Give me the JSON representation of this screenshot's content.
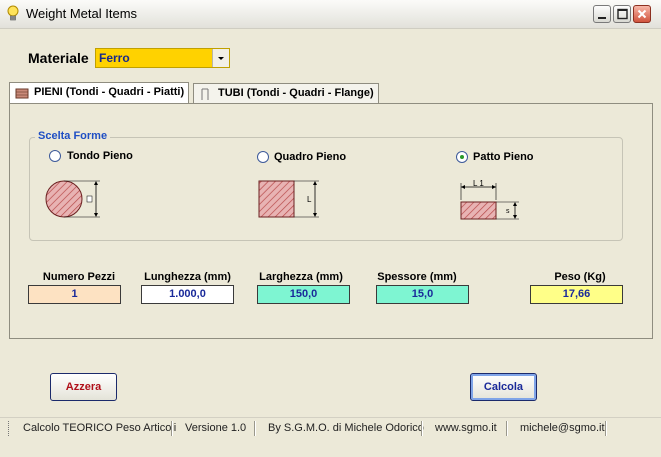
{
  "window": {
    "title": "Weight Metal Items",
    "icon": "lightbulb-icon"
  },
  "materiale": {
    "label": "Materiale",
    "selected": "Ferro"
  },
  "tabs": [
    {
      "label": "PIENI (Tondi - Quadri - Piatti)",
      "active": true,
      "icon": "solid-bar-icon"
    },
    {
      "label": "TUBI (Tondi - Quadri - Flange)",
      "active": false,
      "icon": "tube-icon"
    }
  ],
  "scelta_forme": {
    "title": "Scelta Forme",
    "options": [
      {
        "label": "Tondo Pieno",
        "checked": false,
        "dim": "D"
      },
      {
        "label": "Quadro Pieno",
        "checked": false,
        "dim": "L"
      },
      {
        "label": "Patto Pieno",
        "checked": true,
        "dim": "L 1"
      }
    ]
  },
  "fields": {
    "numero_pezzi": {
      "label": "Numero Pezzi",
      "value": "1",
      "color": "#fde2c2"
    },
    "lunghezza": {
      "label": "Lunghezza  (mm)",
      "value": "1.000,0",
      "color": "#ffffff"
    },
    "larghezza": {
      "label": "Larghezza (mm)",
      "value": "150,0",
      "color": "#7ef5d2"
    },
    "spessore": {
      "label": "Spessore  (mm)",
      "value": "15,0",
      "color": "#7ef5d2"
    },
    "peso": {
      "label": "Peso  (Kg)",
      "value": "17,66",
      "color": "#ffff88"
    }
  },
  "buttons": {
    "azzera": "Azzera",
    "calcola": "Calcola"
  },
  "status": {
    "item1": "Calcolo TEORICO Peso Articoli",
    "item2": "Versione 1.0",
    "item3": "By S.G.M.O. di Michele Odorico",
    "item4": "www.sgmo.it",
    "item5": "michele@sgmo.it"
  }
}
